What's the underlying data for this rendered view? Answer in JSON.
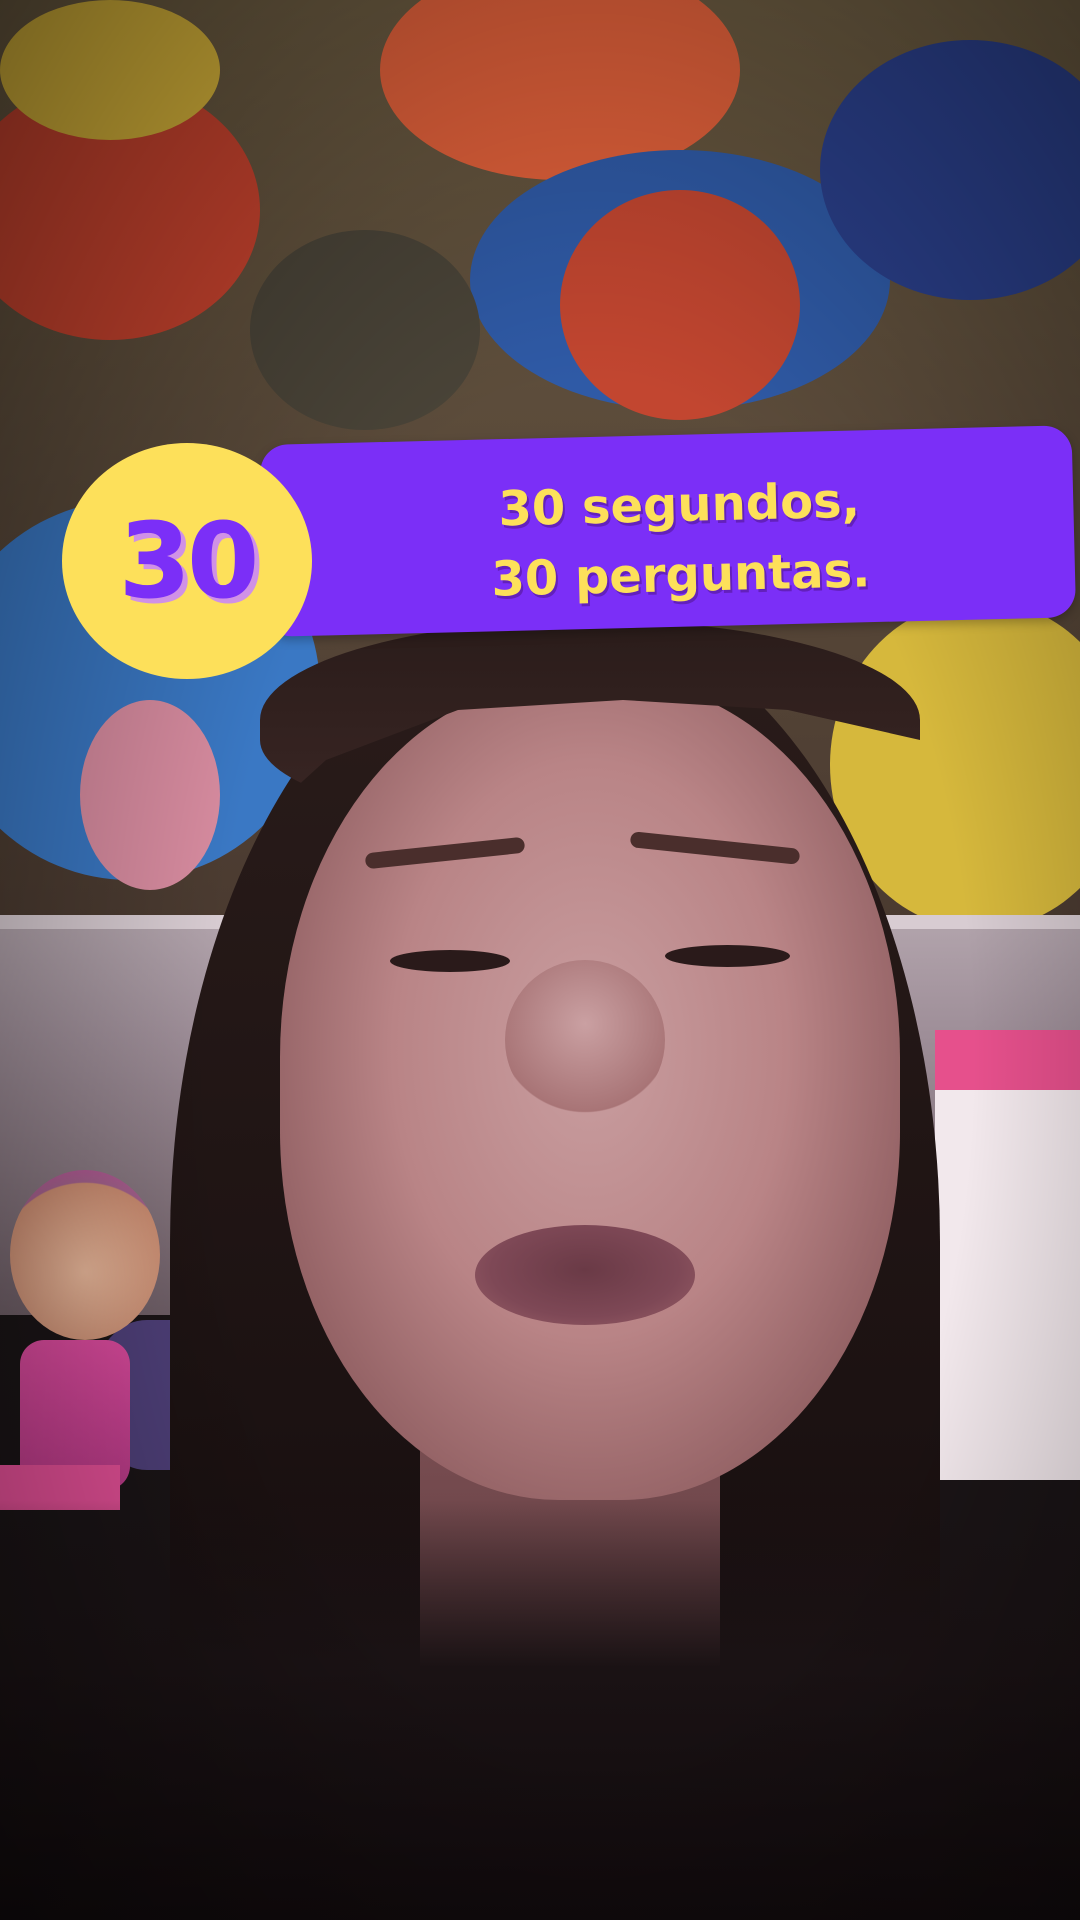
{
  "overlay": {
    "badge_number": "30",
    "title_line1": "30 segundos,",
    "title_line2": "30 perguntas."
  },
  "colors": {
    "banner": "#7b2ff7",
    "badge": "#fde05a",
    "text_accent": "#fde05a"
  }
}
